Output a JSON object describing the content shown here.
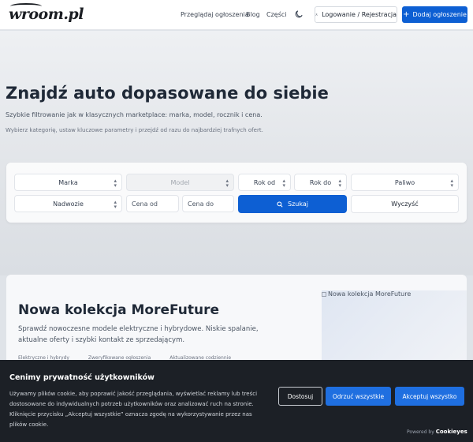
{
  "header": {
    "logo_text": "wroom.pl",
    "nav": [
      "Przeglądaj ogłoszenia",
      "Blog",
      "Części"
    ],
    "login_label": "Logowanie / Rejestracja",
    "add_label": "Dodaj ogłoszenie"
  },
  "hero": {
    "title": "Znajdź auto dopasowane do siebie",
    "subtitle": "Szybkie filtrowanie jak w klasycznych marketplace: marka, model, rocznik i cena.",
    "description": "Wybierz kategorię, ustaw kluczowe parametry i przejdź od razu do najbardziej trafnych ofert."
  },
  "filters": {
    "make": "Marka",
    "model": "Model",
    "year_from": "Rok od",
    "year_to": "Rok do",
    "fuel": "Paliwo",
    "body": "Nadwozie",
    "price_from_placeholder": "Cena od",
    "price_to_placeholder": "Cena do",
    "search_label": "Szukaj",
    "clear_label": "Wyczyść"
  },
  "promo": {
    "title": "Nowa kolekcja MoreFuture",
    "description": "Sprawdź nowoczesne modele elektryczne i hybrydowe. Niskie spalanie, aktualne oferty i szybki kontakt ze sprzedającym.",
    "tags": [
      "Elektryczne i hybrydy",
      "Zweryfikowane ogłoszenia",
      "Aktualizowane codziennie"
    ],
    "image_alt": "Nowa kolekcja MoreFuture"
  },
  "cookie": {
    "title": "Cenimy prywatność użytkowników",
    "text": "Używamy plików cookie, aby poprawić jakość przeglądania, wyświetlać reklamy lub treści dostosowane do indywidualnych potrzeb użytkowników oraz analizować ruch na stronie. Kliknięcie przycisku „Akceptuj wszystkie” oznacza zgodę na wykorzystywanie przez nas plików cookie.",
    "customize_label": "Dostosuj",
    "reject_label": "Odrzuć wszystkie",
    "accept_label": "Akceptuj wszystko",
    "powered_by": "Powered by",
    "brand": "Cookieyes"
  },
  "colors": {
    "primary": "#0d5fd3",
    "cookie_bg": "#1c2026",
    "cookie_button": "#1f6fe0"
  }
}
